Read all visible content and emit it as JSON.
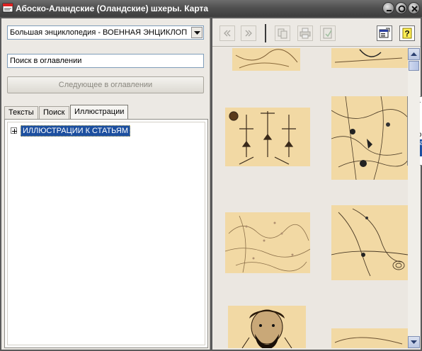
{
  "window": {
    "title": "Абоско-Аландские (Оландские) шхеры. Карта"
  },
  "left_panel": {
    "source_combo": {
      "value": "Большая энциклопедия - ВОЕННАЯ ЭНЦИКЛОП"
    },
    "search": {
      "value": "Поиск в оглавлении"
    },
    "next_button": {
      "label": "Следующее в оглавлении"
    },
    "tabs": [
      {
        "label": "Тексты"
      },
      {
        "label": "Поиск"
      },
      {
        "label": "Иллюстрации",
        "active": true
      }
    ],
    "tree": {
      "items": [
        {
          "label": "ИЛЛЮСТРАЦИИ К СТАТЬЯМ",
          "selected": true,
          "expanded": false
        }
      ]
    }
  },
  "toolbar": {
    "buttons": [
      {
        "icon": "back-double-chevron-icon",
        "enabled": false
      },
      {
        "icon": "forward-double-chevron-icon",
        "enabled": false
      },
      {
        "icon": "copy-icon",
        "enabled": false
      },
      {
        "icon": "print-icon",
        "enabled": false
      },
      {
        "icon": "bookmark-icon",
        "enabled": false
      },
      {
        "icon": "properties-icon",
        "enabled": true
      },
      {
        "icon": "help-icon",
        "enabled": true
      }
    ]
  },
  "tooltip": {
    "lines": [
      "кма",
      "ния",
      "ния",
      "нск",
      ". Ср",
      "-Ала",
      "скр"
    ]
  },
  "colors": {
    "titlebar": "#4a4a4a",
    "panel": "#ece9e4",
    "selection": "#1c4fa0",
    "thumbnail": "#f2d9a4"
  }
}
